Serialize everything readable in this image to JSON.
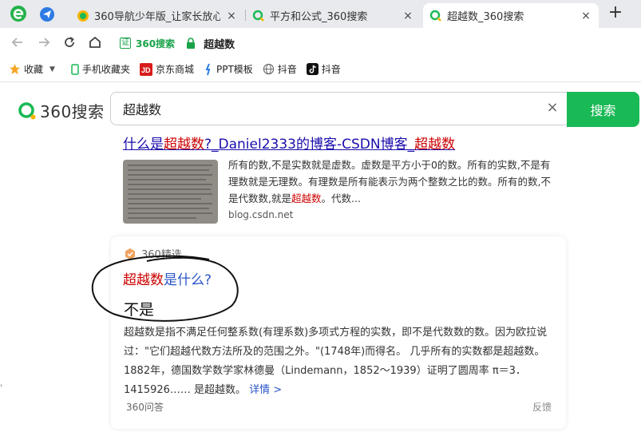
{
  "tabs": [
    {
      "title": "360导航少年版_让家长放心，",
      "close": "×",
      "active": false
    },
    {
      "title": "平方和公式_360搜索",
      "close": "×",
      "active": false
    },
    {
      "title": "超越数_360搜索",
      "close": "×",
      "active": true
    }
  ],
  "new_tab": "+",
  "address": {
    "cert_icon": "证",
    "cert_label": "360搜索",
    "url": "超越数"
  },
  "bookmarks": [
    {
      "label": "收藏",
      "icon": "star-icon"
    },
    {
      "label": "手机收藏夹",
      "icon": "phone-icon"
    },
    {
      "label": "京东商城",
      "icon": "jd-icon"
    },
    {
      "label": "PPT模板",
      "icon": "ppt-icon"
    },
    {
      "label": "抖音",
      "icon": "globe-icon"
    },
    {
      "label": "抖音",
      "icon": "tiktok-icon"
    }
  ],
  "search": {
    "logo_text": "360搜索",
    "query": "超越数",
    "clear": "×",
    "button": "搜索"
  },
  "result1": {
    "title_a": "什么是",
    "title_b": "超越数",
    "title_c": "?_Daniel2333的博客-CSDN博客_",
    "title_d": "超越数",
    "snippet_a": "所有的数,不是实数就是虚数。虚数是平方小于0的数。所有的实数,不是有理数就是无理数。有理数是所有能表示为两个整数之比的数。所有的数,不是代数数,就是",
    "snippet_hl": "超越数",
    "snippet_b": "。代数...",
    "url": "blog.csdn.net"
  },
  "card": {
    "badge": "360精选",
    "question_hl": "超越数",
    "question_rest": "是什么?",
    "answer": "不是",
    "body": "超越数是指不满足任何整系数(有理系数)多项式方程的实数，即不是代数数的数。因为欧拉说过：\"它们超越代数方法所及的范围之外。\"(1748年)而得名。 几乎所有的实数都是超越数。 1882年，德国数学数学家林德曼（Lindemann，1852～1939）证明了圆周率 π＝3．1415926…… 是超越数。",
    "more": "详情 >",
    "source": "360问答",
    "feedback": "反馈"
  },
  "colors": {
    "brand_green": "#19b955",
    "link_blue": "#1a0dab",
    "highlight_red": "#cc0000"
  }
}
